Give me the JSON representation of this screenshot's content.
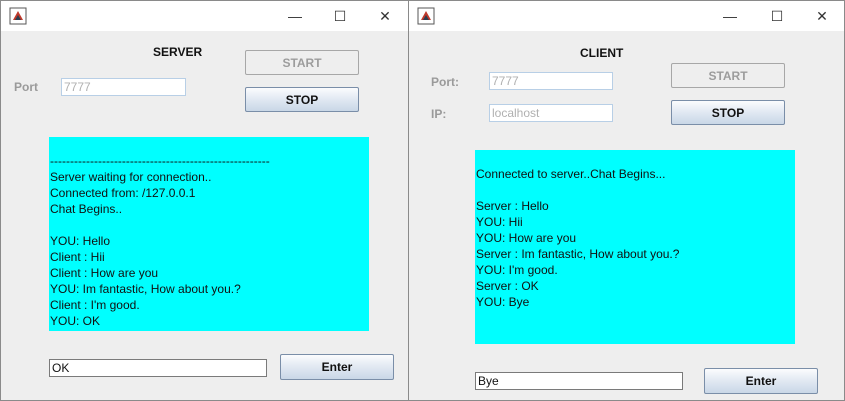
{
  "server": {
    "title": "SERVER",
    "port_label": "Port",
    "port_value": "7777",
    "start_label": "START",
    "stop_label": "STOP",
    "chat_lines": [
      "-------------------------------------------------------",
      "Server waiting for connection..",
      "Connected from: /127.0.0.1",
      "Chat Begins..",
      "",
      "YOU: Hello",
      "Client : Hii",
      "Client : How are you",
      "YOU: Im fantastic, How about you.?",
      "Client : I'm good.",
      "YOU: OK"
    ],
    "input_value": "OK",
    "enter_label": "Enter"
  },
  "client": {
    "title": "CLIENT",
    "port_label": "Port:",
    "port_value": "7777",
    "ip_label": "IP:",
    "ip_value": "localhost",
    "start_label": "START",
    "stop_label": "STOP",
    "chat_lines": [
      "Connected to server..Chat Begins...",
      "",
      "Server : Hello",
      "YOU: Hii",
      "YOU: How are you",
      "Server : Im fantastic, How about you.?",
      "YOU: I'm good.",
      "Server : OK",
      "YOU: Bye"
    ],
    "input_value": "Bye",
    "enter_label": "Enter"
  },
  "titlebar": {
    "minimize_glyph": "—",
    "maximize_glyph": "☐",
    "close_glyph": "✕"
  },
  "colors": {
    "chat_background": "#00ffff",
    "window_background": "#eeeeee"
  },
  "icons": [
    "java-app-icon",
    "minimize-icon",
    "maximize-icon",
    "close-icon"
  ]
}
